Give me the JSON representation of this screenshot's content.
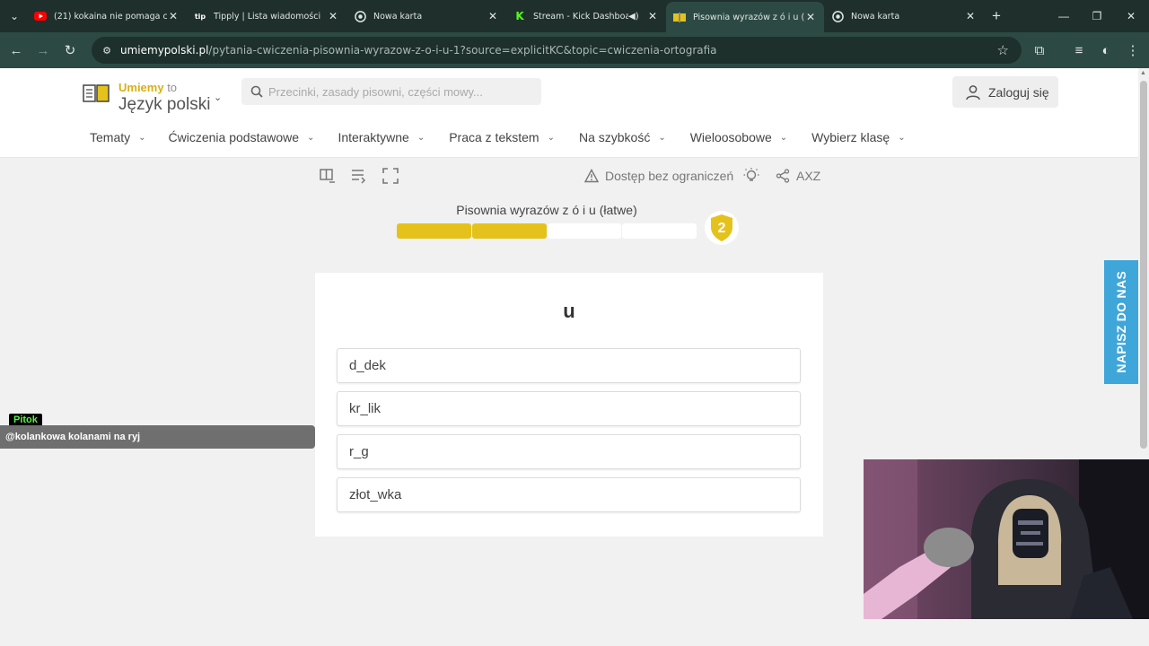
{
  "browser": {
    "tabs": [
      {
        "title": "(21) kokaina nie pomaga ci w d",
        "favicon": "youtube-icon",
        "active": false
      },
      {
        "title": "Tipply | Lista wiadomości",
        "favicon": "tipply-icon",
        "active": false
      },
      {
        "title": "Nowa karta",
        "favicon": "chrome-icon",
        "active": false
      },
      {
        "title": "Stream - Kick Dashboard",
        "favicon": "kick-icon",
        "active": false,
        "audio": true
      },
      {
        "title": "Pisownia wyrazów z ó i u (łatwe)",
        "favicon": "umiemy-icon",
        "active": true
      },
      {
        "title": "Nowa karta",
        "favicon": "chrome-icon",
        "active": false
      }
    ],
    "url_host": "umiemypolski.pl",
    "url_path": "/pytania-cwiczenia-pisownia-wyrazow-z-o-i-u-1?source=explicitKC&topic=cwiczenia-ortografia"
  },
  "header": {
    "logo_top_a": "Umiemy",
    "logo_top_b": " to",
    "logo_sub": "Język polski",
    "search_placeholder": "Przecinki, zasady pisowni, części mowy...",
    "login_label": "Zaloguj się"
  },
  "menu": [
    {
      "label": "Tematy"
    },
    {
      "label": "Ćwiczenia podstawowe"
    },
    {
      "label": "Interaktywne"
    },
    {
      "label": "Praca z tekstem"
    },
    {
      "label": "Na szybkość"
    },
    {
      "label": "Wieloosobowe"
    },
    {
      "label": "Wybierz klasę"
    }
  ],
  "toolbar": {
    "access_label": "Dostęp bez ograniczeń",
    "share_label": "AXZ"
  },
  "exercise": {
    "title": "Pisownia wyrazów z ó i u (łatwe)",
    "progress_segments_total": 4,
    "progress_segments_filled": 2,
    "badge_level": "2",
    "question": "u",
    "answers": [
      "d_dek",
      "kr_lik",
      "r_g",
      "złot_wka"
    ]
  },
  "contact_tab": "NAPISZ DO NAS",
  "overlay": {
    "chat_user": "Pitok",
    "chat_message": "@kolankowa kolanami na ryj"
  },
  "colors": {
    "accent_yellow": "#e4c21b",
    "contact_blue": "#3fa6d9",
    "browser_dark": "#1f2f2b"
  }
}
